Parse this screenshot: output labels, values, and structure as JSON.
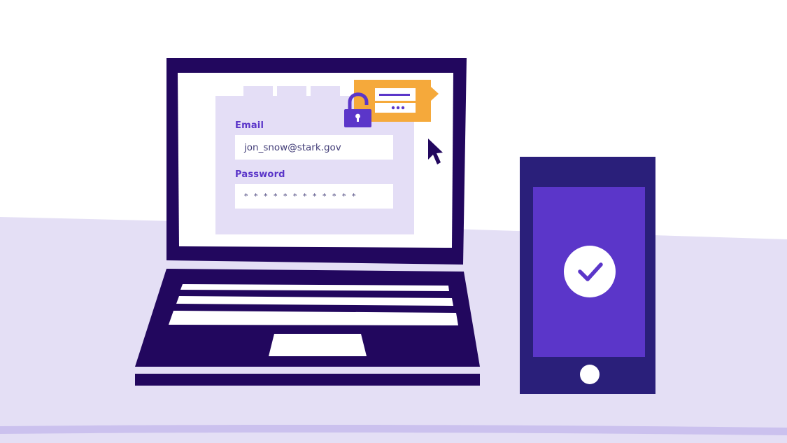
{
  "login_form": {
    "email_label": "Email",
    "email_value": "jon_snow@stark.gov",
    "password_label": "Password",
    "password_value": "* * * * * * * * * * * *"
  },
  "icons": {
    "lock": "unlocked-padlock-icon",
    "password_bubble": "password-tooltip-icon",
    "cursor": "mouse-cursor-icon",
    "checkmark": "checkmark-circle-icon",
    "home_button": "home-button-icon"
  },
  "colors": {
    "dark_navy": "#22075e",
    "violet": "#5b36c9",
    "lavender": "#e4def6",
    "orange": "#f5a93b",
    "phone_body": "#2a1f7a"
  }
}
